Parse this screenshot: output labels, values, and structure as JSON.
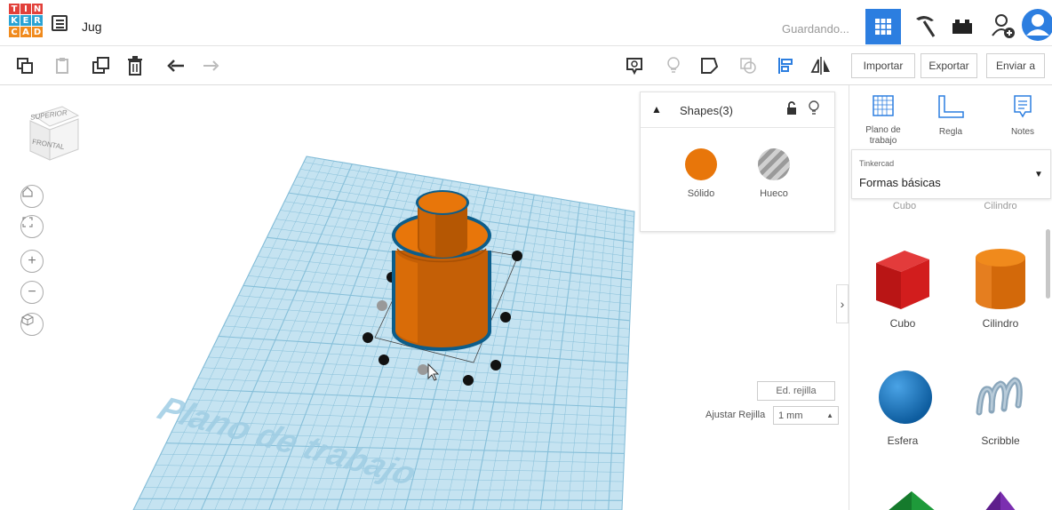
{
  "app": {
    "logo_letters": [
      "T",
      "I",
      "N",
      "K",
      "E",
      "R",
      "C",
      "A",
      "D"
    ],
    "logo_colors": [
      "#e2403a",
      "#e2403a",
      "#e2403a",
      "#2aa3d4",
      "#2aa3d4",
      "#2aa3d4",
      "#f08a1c",
      "#f08a1c",
      "#f08a1c"
    ],
    "design_title": "Jug",
    "save_status": "Guardando...",
    "accent_color": "#2c7ee0"
  },
  "header_icons": [
    "list-icon",
    "grid-view-icon",
    "pickaxe-icon",
    "bricks-icon",
    "add-user-icon",
    "avatar-icon"
  ],
  "toolbar": {
    "import_label": "Importar",
    "export_label": "Exportar",
    "send_label": "Enviar a",
    "icons": [
      "copy-icon",
      "paste-icon",
      "duplicate-icon",
      "delete-icon",
      "undo-icon",
      "redo-icon",
      "notes-bubble-icon",
      "light-icon",
      "shape-outline-icon",
      "group-icon",
      "align-icon",
      "mirror-icon"
    ]
  },
  "viewcube": {
    "top_label": "SUPERIOR",
    "front_label": "FRONTAL"
  },
  "nav_controls": [
    "home-view",
    "fit-view",
    "zoom-in",
    "zoom-out",
    "perspective"
  ],
  "workplane": {
    "label": "Plano de trabajo",
    "grid_color": "#a9d5ea",
    "edit_grid_label": "Ed. rejilla",
    "snap_label": "Ajustar Rejilla",
    "snap_value": "1 mm"
  },
  "inspector": {
    "title": "Shapes(3)",
    "solid_label": "Sólido",
    "hole_label": "Hueco",
    "solid_color": "#e8760a"
  },
  "right_panel": {
    "tools": [
      {
        "label": "Plano de trabajo",
        "icon": "workplane-icon"
      },
      {
        "label": "Regla",
        "icon": "ruler-icon"
      },
      {
        "label": "Notes",
        "icon": "notes-icon"
      }
    ],
    "library_source": "Tinkercad",
    "library_name": "Formas básicas",
    "cut_labels": [
      "Cubo",
      "Cilindro"
    ],
    "shapes": [
      {
        "label": "Cubo",
        "color": "#d21d1d"
      },
      {
        "label": "Cilindro",
        "color": "#e8760a"
      },
      {
        "label": "Esfera",
        "color": "#1b78c2"
      },
      {
        "label": "Scribble",
        "color": "#8aa6bb"
      }
    ]
  }
}
